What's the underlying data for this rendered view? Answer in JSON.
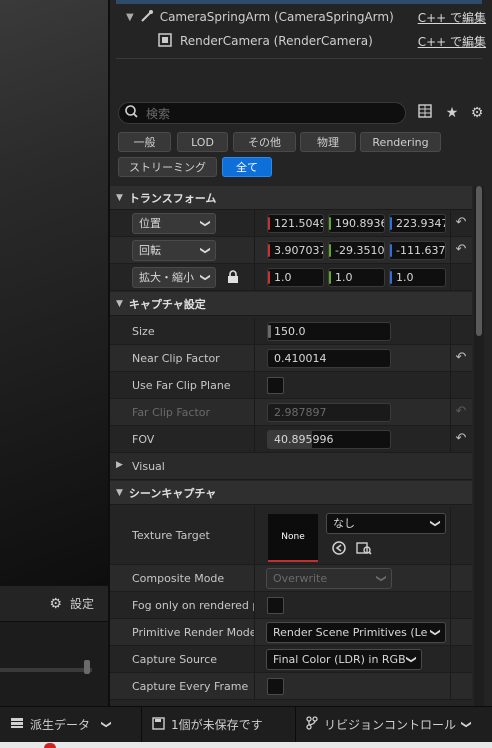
{
  "tree": {
    "items": [
      {
        "label": "CameraSpringArm (CameraSpringArm)",
        "link": "C++ で編集"
      },
      {
        "label": "RenderCamera (RenderCamera)",
        "link": "C++ で編集"
      }
    ]
  },
  "search": {
    "placeholder": "検索"
  },
  "filters": [
    "一般",
    "LOD",
    "その他",
    "物理",
    "Rendering",
    "ストリーミング",
    "全て"
  ],
  "sections": {
    "transform": "トランスフォーム",
    "capture": "キャプチャ設定",
    "scene_capture": "シーンキャプチャ"
  },
  "transform": {
    "location": {
      "label": "位置",
      "x": "121.5049",
      "y": "190.8936",
      "z": "223.9347"
    },
    "rotation": {
      "label": "回転",
      "x": "3.907037",
      "y": "-29.3510",
      "z": "-111.637"
    },
    "scale": {
      "label": "拡大・縮小",
      "x": "1.0",
      "y": "1.0",
      "z": "1.0"
    }
  },
  "capture": {
    "size": {
      "label": "Size",
      "value": "150.0"
    },
    "near_clip": {
      "label": "Near Clip Factor",
      "value": "0.410014"
    },
    "use_far_clip": {
      "label": "Use Far Clip Plane"
    },
    "far_clip": {
      "label": "Far Clip Factor",
      "value": "2.987897"
    },
    "fov": {
      "label": "FOV",
      "value": "40.895996"
    },
    "visual": {
      "label": "Visual"
    }
  },
  "scene_capture": {
    "texture_target": {
      "label": "Texture Target",
      "thumb": "None",
      "value": "なし"
    },
    "composite_mode": {
      "label": "Composite Mode",
      "value": "Overwrite"
    },
    "fog_only": {
      "label": "Fog only on rendered p..."
    },
    "primitive_render_mode": {
      "label": "Primitive Render Mode",
      "value": "Render Scene Primitives (Le"
    },
    "capture_source": {
      "label": "Capture Source",
      "value": "Final Color (LDR) in RGB"
    },
    "capture_every_frame": {
      "label": "Capture Every Frame"
    }
  },
  "left": {
    "settings_label": "設定"
  },
  "status": {
    "derived_data": "派生データ",
    "unsaved": "1個が未保存です",
    "revision": "リビジョンコントロール"
  },
  "colors": {
    "accent": "#0e6fd8",
    "axis_x": "#c83232",
    "axis_y": "#5fa832",
    "axis_z": "#2f6fd8"
  }
}
